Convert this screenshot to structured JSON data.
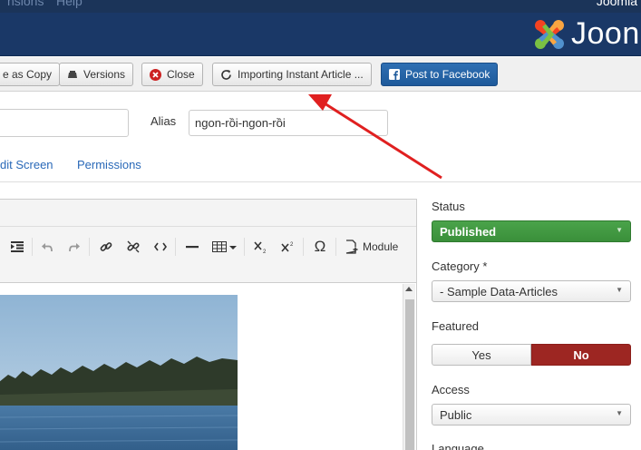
{
  "menubar": {
    "item1": "nsions",
    "item2": "Help",
    "user": "Joomla"
  },
  "header": {
    "logo_text": "Joon"
  },
  "toolbar": {
    "save_copy": "e as Copy",
    "versions": "Versions",
    "close": "Close",
    "importing": "Importing Instant Article ...",
    "post_facebook": "Post to Facebook"
  },
  "details": {
    "alias_label": "Alias",
    "alias_value": "ngon-rồi-ngon-rồi"
  },
  "tabs": {
    "edit_screen": "dit Screen",
    "permissions": "Permissions"
  },
  "editor": {
    "module_label": "Module"
  },
  "sidebar": {
    "status_label": "Status",
    "status_value": "Published",
    "category_label": "Category *",
    "category_value": "- Sample Data-Articles",
    "featured_label": "Featured",
    "featured_yes": "Yes",
    "featured_no": "No",
    "access_label": "Access",
    "access_value": "Public",
    "language_label": "Language"
  },
  "colors": {
    "header_bg": "#1a3867",
    "status_green": "#3d9a3d",
    "no_red": "#9d2622",
    "facebook_blue": "#1e5a9b",
    "annotation_arrow": "#e02020"
  }
}
